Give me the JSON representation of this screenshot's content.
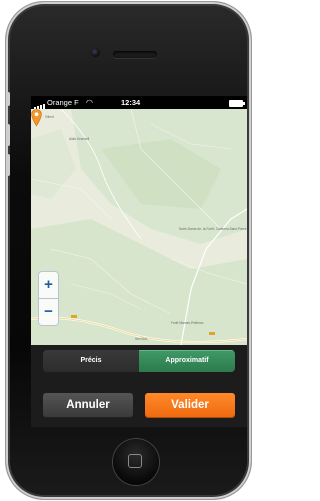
{
  "status_bar": {
    "carrier": "Orange F",
    "time": "12:34"
  },
  "map": {
    "zoom_in": "+",
    "zoom_out": "−",
    "labels": [
      "Villenf",
      "Aldis\nOrsenvill",
      "Notre-Dame-de-\nla-Forêt-\nCarlinem-Saint-Pierre",
      "Forêt\nMarnes-Pellenon",
      "Sen Bon-"
    ]
  },
  "precision_control": {
    "left_label": "Précis",
    "right_label": "Approximatif",
    "selected": "Approximatif"
  },
  "actions": {
    "cancel_label": "Annuler",
    "ok_label": "Valider"
  },
  "colors": {
    "accent_green": "#3f9a66",
    "accent_orange": "#f4791c",
    "pin": "#f39628"
  }
}
